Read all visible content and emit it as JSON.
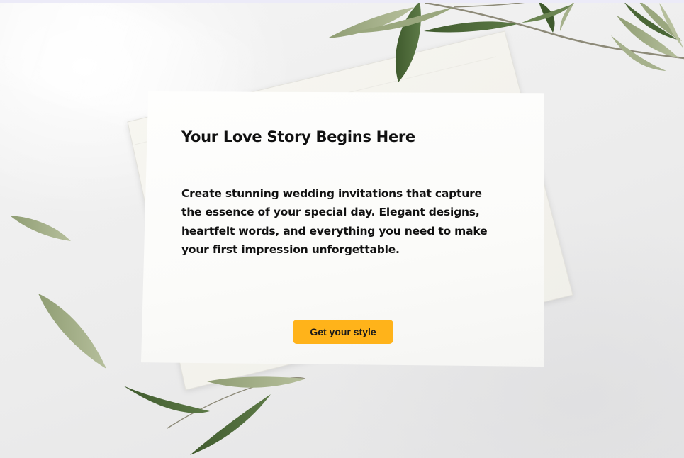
{
  "card": {
    "title": "Your Love Story Begins Here",
    "body": "Create stunning wedding invitations that capture the essence of your special day. Elegant designs, heartfelt words, and everything you need to make your first impression unforgettable.",
    "cta_label": "Get your style"
  },
  "colors": {
    "accent": "#ffb31a",
    "text": "#111111",
    "card": "#fcfcfa",
    "leaf_dark": "#4f6b3c",
    "leaf_light": "#a6b18c"
  },
  "decor": {
    "background_icon": "olive-branch-icon",
    "envelope_icon": "envelope-icon"
  }
}
